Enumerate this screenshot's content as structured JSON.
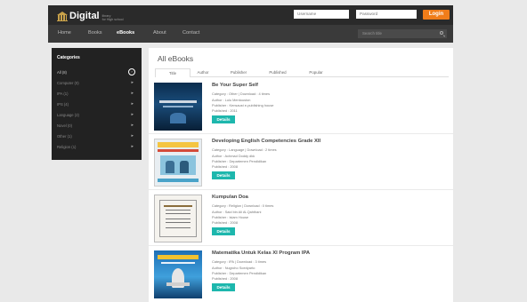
{
  "logo": {
    "name": "Digital",
    "tagline": "library\nfor High school"
  },
  "login": {
    "username_placeholder": "Username",
    "password_placeholder": "Password",
    "button": "Login"
  },
  "nav": {
    "items": [
      "Home",
      "Books",
      "eBooks",
      "About",
      "Contact"
    ],
    "active": "eBooks",
    "search_placeholder": "Search title"
  },
  "sidebar": {
    "title": "Categories",
    "items": [
      "All (8)",
      "Computer (0)",
      "IPA (1)",
      "IPS (4)",
      "Language (2)",
      "Novel (0)",
      "Other (1)",
      "Religion (1)"
    ]
  },
  "main": {
    "title": "All eBooks",
    "tabs": [
      "Title",
      "Author",
      "Publisher",
      "Published",
      "Popular"
    ],
    "active_tab": "Title",
    "details_label": "Details",
    "books": [
      {
        "title": "Be Your Super Self",
        "category": "Category : Other | Download : 4 times",
        "author": "Author : Lulu Mentouston",
        "publisher": "Publisher : Kensaust e-publishing house",
        "published": "Published : 2011"
      },
      {
        "title": "Developing English Competencies Grade XII",
        "category": "Category : Language | Download : 2 times",
        "author": "Author : Achmad Doddy dkk",
        "publisher": "Publisher : Departemen Pendidikan",
        "published": "Published : 2008"
      },
      {
        "title": "Kumpulan Doa",
        "category": "Category : Religion | Download : 0 times",
        "author": "Author : Said bin Ali Al-Qahthani",
        "publisher": "Publisher : Islam House",
        "published": "Published : 2008"
      },
      {
        "title": "Matematika Untuk Kelas XI Program IPA",
        "category": "Category : IPA | Download : 3 times",
        "author": "Author : Nugroho Soedyarto",
        "publisher": "Publisher : Departemen Pendidikan",
        "published": "Published : 2008"
      }
    ]
  },
  "colors": {
    "topbar": "#2a2a2a",
    "navbar": "#3a3a3a",
    "sidebar": "#222222",
    "login": "#f07d1a",
    "details": "#1db7ad"
  },
  "icons": [
    "search-icon",
    "arrow-right-icon",
    "logo-icon"
  ]
}
